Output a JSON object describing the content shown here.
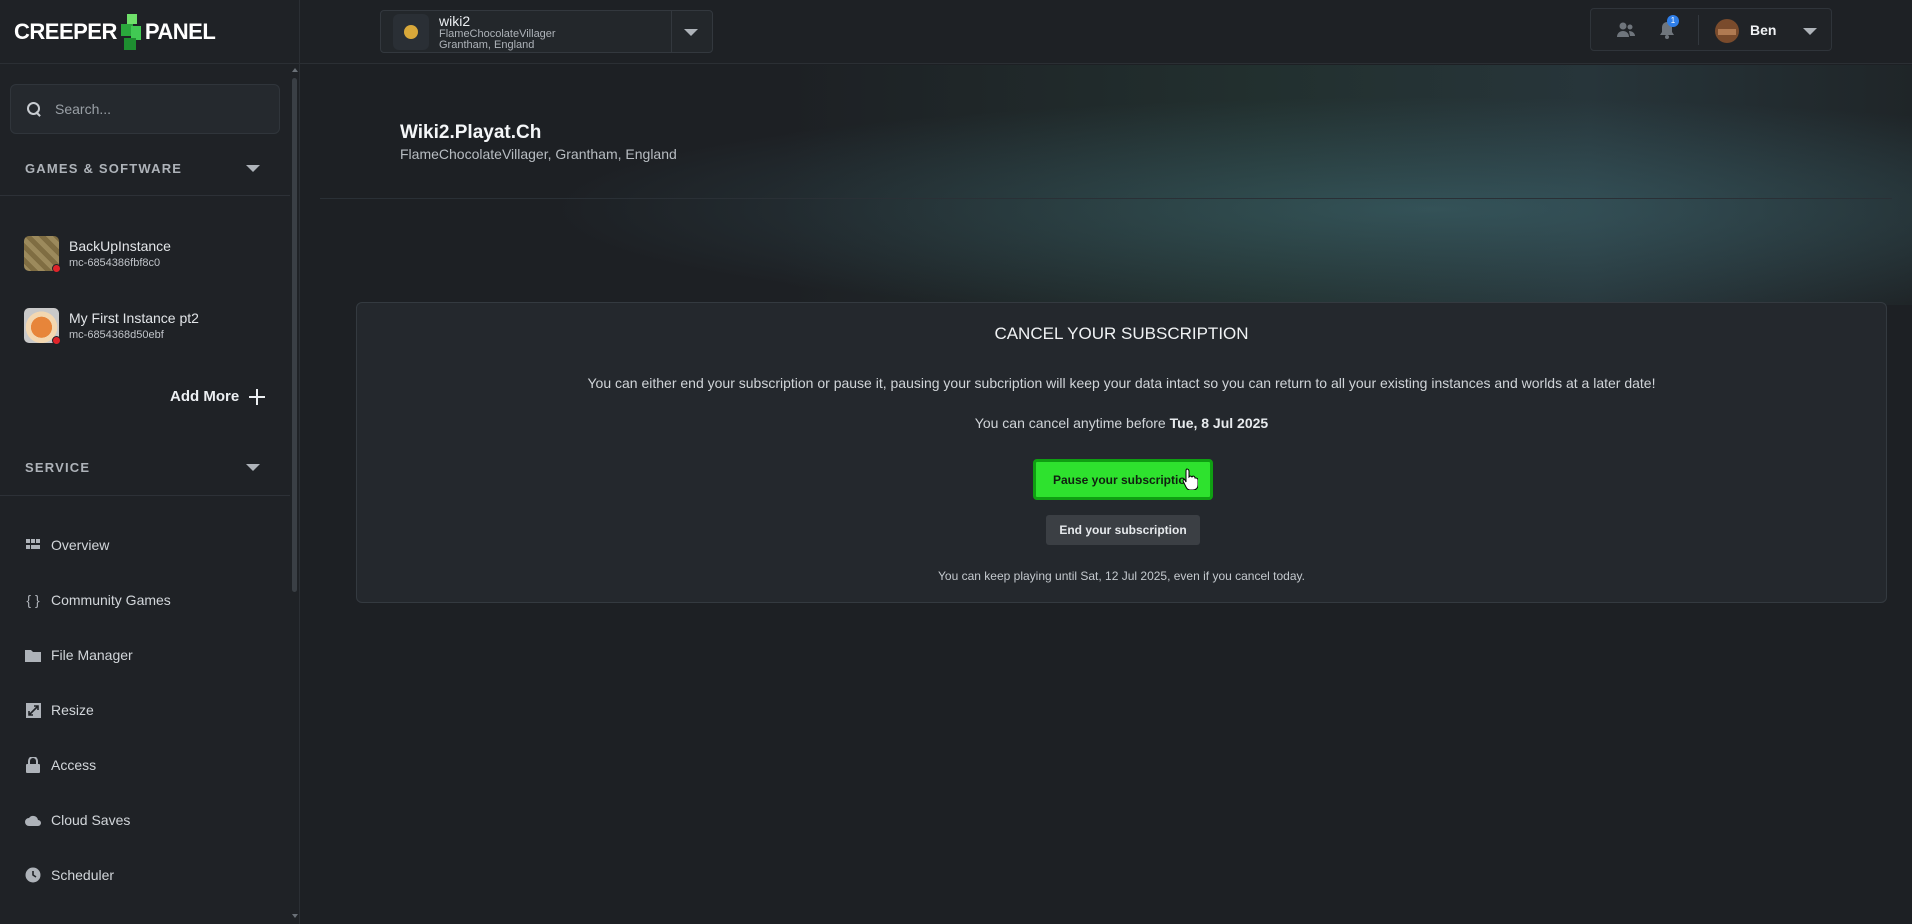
{
  "brand": {
    "left": "CREEPER",
    "right": "PANEL"
  },
  "search": {
    "placeholder": "Search..."
  },
  "sidebar": {
    "sections": [
      {
        "label": "GAMES & SOFTWARE"
      },
      {
        "label": "SERVICE"
      }
    ],
    "instances": [
      {
        "name": "BackUpInstance",
        "id": "mc-6854386fbf8c0",
        "status_color": "#e0242a"
      },
      {
        "name": "My First Instance pt2",
        "id": "mc-6854368d50ebf",
        "status_color": "#e0242a"
      }
    ],
    "add_more": "Add More",
    "nav": [
      {
        "label": "Overview",
        "icon": "grid-icon"
      },
      {
        "label": "Community Games",
        "icon": "braces-icon"
      },
      {
        "label": "File Manager",
        "icon": "folder-icon"
      },
      {
        "label": "Resize",
        "icon": "resize-icon"
      },
      {
        "label": "Access",
        "icon": "lock-icon"
      },
      {
        "label": "Cloud Saves",
        "icon": "cloud-icon"
      },
      {
        "label": "Scheduler",
        "icon": "clock-icon"
      }
    ]
  },
  "server": {
    "name": "wiki2",
    "owner": "FlameChocolateVillager",
    "location": "Grantham, England"
  },
  "user": {
    "name": "Ben",
    "notifications": "1"
  },
  "page": {
    "title": "Wiki2.Playat.Ch",
    "subtitle": "FlameChocolateVillager, Grantham, England"
  },
  "card": {
    "title": "CANCEL YOUR SUBSCRIPTION",
    "text": "You can either end your subscription or pause it, pausing your subcription will keep your data intact so you can return to all your existing instances and worlds at a later date!",
    "deadline_prefix": "You can cancel anytime before ",
    "deadline_date": "Tue, 8 Jul 2025",
    "pause_label": "Pause your subscription",
    "end_label": "End your subscription",
    "note": "You can keep playing until Sat, 12 Jul 2025, even if you cancel today."
  },
  "colors": {
    "accent_green": "#2ee22e",
    "status_red": "#e0242a",
    "badge_blue": "#2f7ee8"
  }
}
